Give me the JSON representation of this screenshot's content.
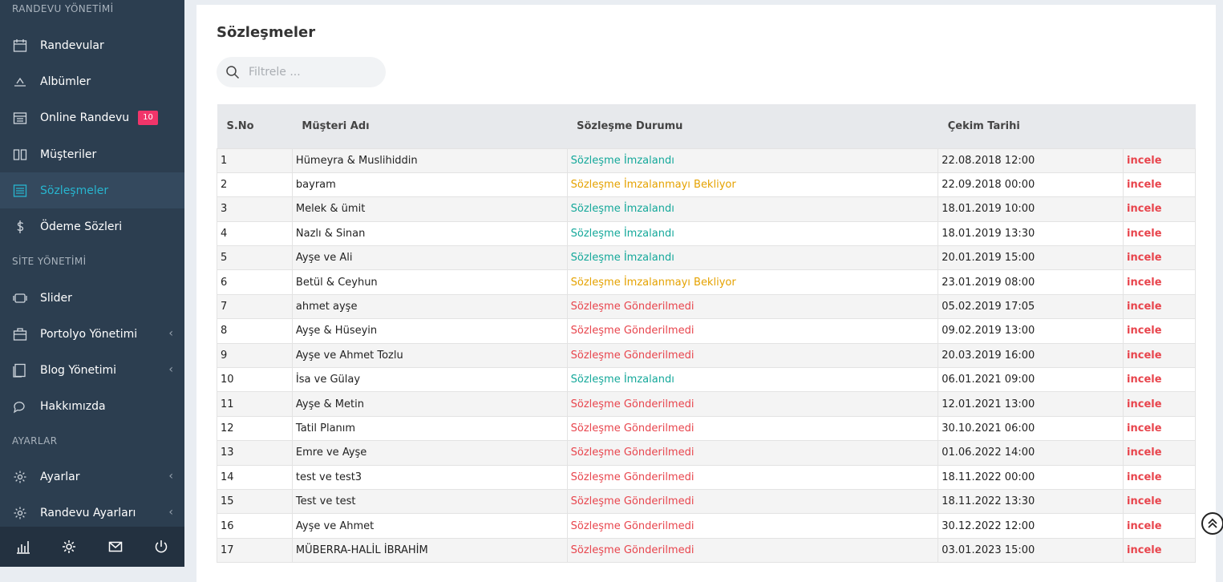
{
  "sidebar": {
    "sections": {
      "randevu": "RANDEVU YÖNETİMİ",
      "site": "SİTE YÖNETİMİ",
      "ayarlar": "AYARLAR"
    },
    "items": [
      {
        "label": "Randevular",
        "icon": "calendar-icon"
      },
      {
        "label": "Albümler",
        "icon": "album-icon"
      },
      {
        "label": "Online Randevu",
        "icon": "calendar-check-icon",
        "badge": "10"
      },
      {
        "label": "Müşteriler",
        "icon": "book-icon"
      },
      {
        "label": "Sözleşmeler",
        "icon": "list-icon",
        "active": true
      },
      {
        "label": "Ödeme Sözleri",
        "icon": "dollar-icon"
      },
      {
        "label": "Slider",
        "icon": "slider-icon"
      },
      {
        "label": "Portolyo Yönetimi",
        "icon": "portfolio-icon"
      },
      {
        "label": "Blog Yönetimi",
        "icon": "blog-icon"
      },
      {
        "label": "Hakkımızda",
        "icon": "chat-icon"
      },
      {
        "label": "Ayarlar",
        "icon": "gear-icon"
      },
      {
        "label": "Randevu Ayarları",
        "icon": "gear-icon"
      }
    ],
    "chevron": "‹",
    "bottom_icons": [
      "stats-icon",
      "settings-icon",
      "mail-icon",
      "power-icon"
    ]
  },
  "main": {
    "title": "Sözleşmeler",
    "search_placeholder": "Filtrele ...",
    "columns": [
      "S.No",
      "Müşteri Adı",
      "Sözleşme Durumu",
      "Çekim Tarihi",
      ""
    ],
    "action_label": "incele",
    "rows": [
      {
        "no": "1",
        "name": "Hümeyra & Muslihiddin",
        "status": "Sözleşme İmzalandı",
        "status_type": "ok",
        "date": "22.08.2018 12:00"
      },
      {
        "no": "2",
        "name": "bayram",
        "status": "Sözleşme İmzalanmayı Bekliyor",
        "status_type": "wait",
        "date": "22.09.2018 00:00"
      },
      {
        "no": "3",
        "name": "Melek & ümit",
        "status": "Sözleşme İmzalandı",
        "status_type": "ok",
        "date": "18.01.2019 10:00"
      },
      {
        "no": "4",
        "name": "Nazlı & Sinan",
        "status": "Sözleşme İmzalandı",
        "status_type": "ok",
        "date": "18.01.2019 13:30"
      },
      {
        "no": "5",
        "name": "Ayşe ve Ali",
        "status": "Sözleşme İmzalandı",
        "status_type": "ok",
        "date": "20.01.2019 15:00"
      },
      {
        "no": "6",
        "name": "Betül & Ceyhun",
        "status": "Sözleşme İmzalanmayı Bekliyor",
        "status_type": "wait",
        "date": "23.01.2019 08:00"
      },
      {
        "no": "7",
        "name": "ahmet ayşe",
        "status": "Sözleşme Gönderilmedi",
        "status_type": "no",
        "date": "05.02.2019 17:05"
      },
      {
        "no": "8",
        "name": "Ayşe & Hüseyin",
        "status": "Sözleşme Gönderilmedi",
        "status_type": "no",
        "date": "09.02.2019 13:00"
      },
      {
        "no": "9",
        "name": "Ayşe ve Ahmet Tozlu",
        "status": "Sözleşme Gönderilmedi",
        "status_type": "no",
        "date": "20.03.2019 16:00"
      },
      {
        "no": "10",
        "name": "İsa ve Gülay",
        "status": "Sözleşme İmzalandı",
        "status_type": "ok",
        "date": "06.01.2021 09:00"
      },
      {
        "no": "11",
        "name": "Ayşe & Metin",
        "status": "Sözleşme Gönderilmedi",
        "status_type": "no",
        "date": "12.01.2021 13:00"
      },
      {
        "no": "12",
        "name": "Tatil Planım",
        "status": "Sözleşme Gönderilmedi",
        "status_type": "no",
        "date": "30.10.2021 06:00"
      },
      {
        "no": "13",
        "name": "Emre ve Ayşe",
        "status": "Sözleşme Gönderilmedi",
        "status_type": "no",
        "date": "01.06.2022 14:00"
      },
      {
        "no": "14",
        "name": "test ve test3",
        "status": "Sözleşme Gönderilmedi",
        "status_type": "no",
        "date": "18.11.2022 00:00"
      },
      {
        "no": "15",
        "name": "Test ve test",
        "status": "Sözleşme Gönderilmedi",
        "status_type": "no",
        "date": "18.11.2022 13:30"
      },
      {
        "no": "16",
        "name": "Ayşe ve Ahmet",
        "status": "Sözleşme Gönderilmedi",
        "status_type": "no",
        "date": "30.12.2022 12:00"
      },
      {
        "no": "17",
        "name": "MÜBERRA-HALİL İBRAHİM",
        "status": "Sözleşme Gönderilmedi",
        "status_type": "no",
        "date": "03.01.2023 15:00"
      }
    ]
  },
  "colors": {
    "sidebar_bg": "#2c3e50",
    "active_text": "#27b5cf",
    "badge": "#f1356a",
    "status_ok": "#14a89a",
    "status_wait": "#e5a200",
    "status_no": "#e8454d"
  },
  "scroll_top_icon": "chevron-double-up-icon"
}
